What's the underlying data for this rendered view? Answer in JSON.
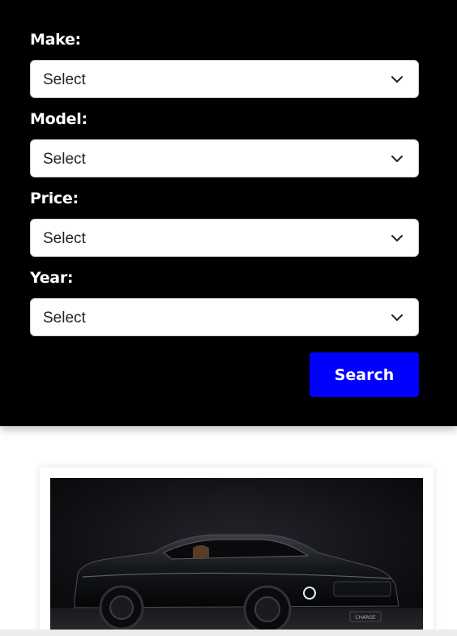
{
  "filters": {
    "fields": [
      {
        "label": "Make:",
        "value": "Select"
      },
      {
        "label": "Model:",
        "value": "Select"
      },
      {
        "label": "Price:",
        "value": "Select"
      },
      {
        "label": "Year:",
        "value": "Select"
      }
    ],
    "search_label": "Search"
  },
  "listing": {
    "plate_text": "CHARGE"
  },
  "colors": {
    "panel_background": "#000000",
    "button_accent": "#0000ff",
    "label_text": "#ffffff"
  },
  "icons": {
    "select_indicator": "chevron-down-icon"
  }
}
